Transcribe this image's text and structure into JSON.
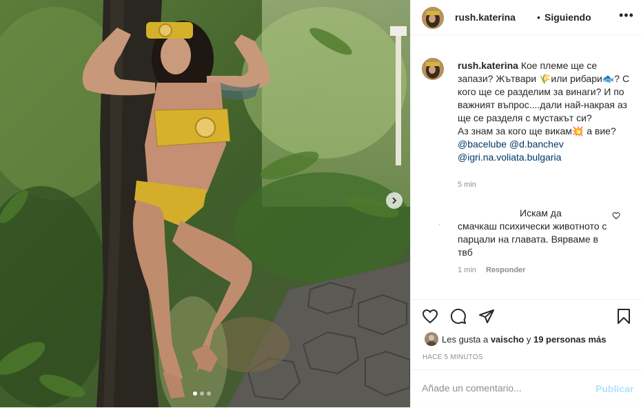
{
  "post": {
    "username": "rush.katerina",
    "separator": "•",
    "follow_status": "Siguiendo",
    "more_icon": "more-horizontal-icon",
    "carousel_dots": 3,
    "carousel_active": 0
  },
  "caption": {
    "username": "rush.katerina",
    "line1": "Кое племе ще се запази? Жътвари ",
    "emoji1": "🌾",
    "line1b": "или рибари",
    "emoji2": "🐟",
    "line1c": "? С кого ще се разделим за винаги? И по важният въпрос....дали най-накрая аз ще се разделя с мустакът си?",
    "line2": "Аз знам за кого ще викам",
    "emoji3": "💥",
    "line2b": " а вие?",
    "mention1": "@bacelube",
    "mention2": "@d.banchev",
    "mention3": "@igri.na.voliata.bulgaria",
    "time": "5 min"
  },
  "comment": {
    "avatar_char": "˙",
    "first": "Искам да",
    "rest": "смачкаш психически животното с парцали на главата. Вярваме в твб",
    "time": "1 min",
    "reply": "Responder"
  },
  "likes": {
    "prefix": "Les gusta a ",
    "user": "vaischo",
    "middle": " y ",
    "count": "19 personas más"
  },
  "posted": "HACE 5 MINUTOS",
  "add_comment": {
    "placeholder": "Añade un comentario...",
    "publish": "Publicar"
  },
  "colors": {
    "link": "#00376b",
    "muted": "#8e8e8e",
    "publish_disabled": "#b2dffc",
    "divider": "#efefef"
  }
}
